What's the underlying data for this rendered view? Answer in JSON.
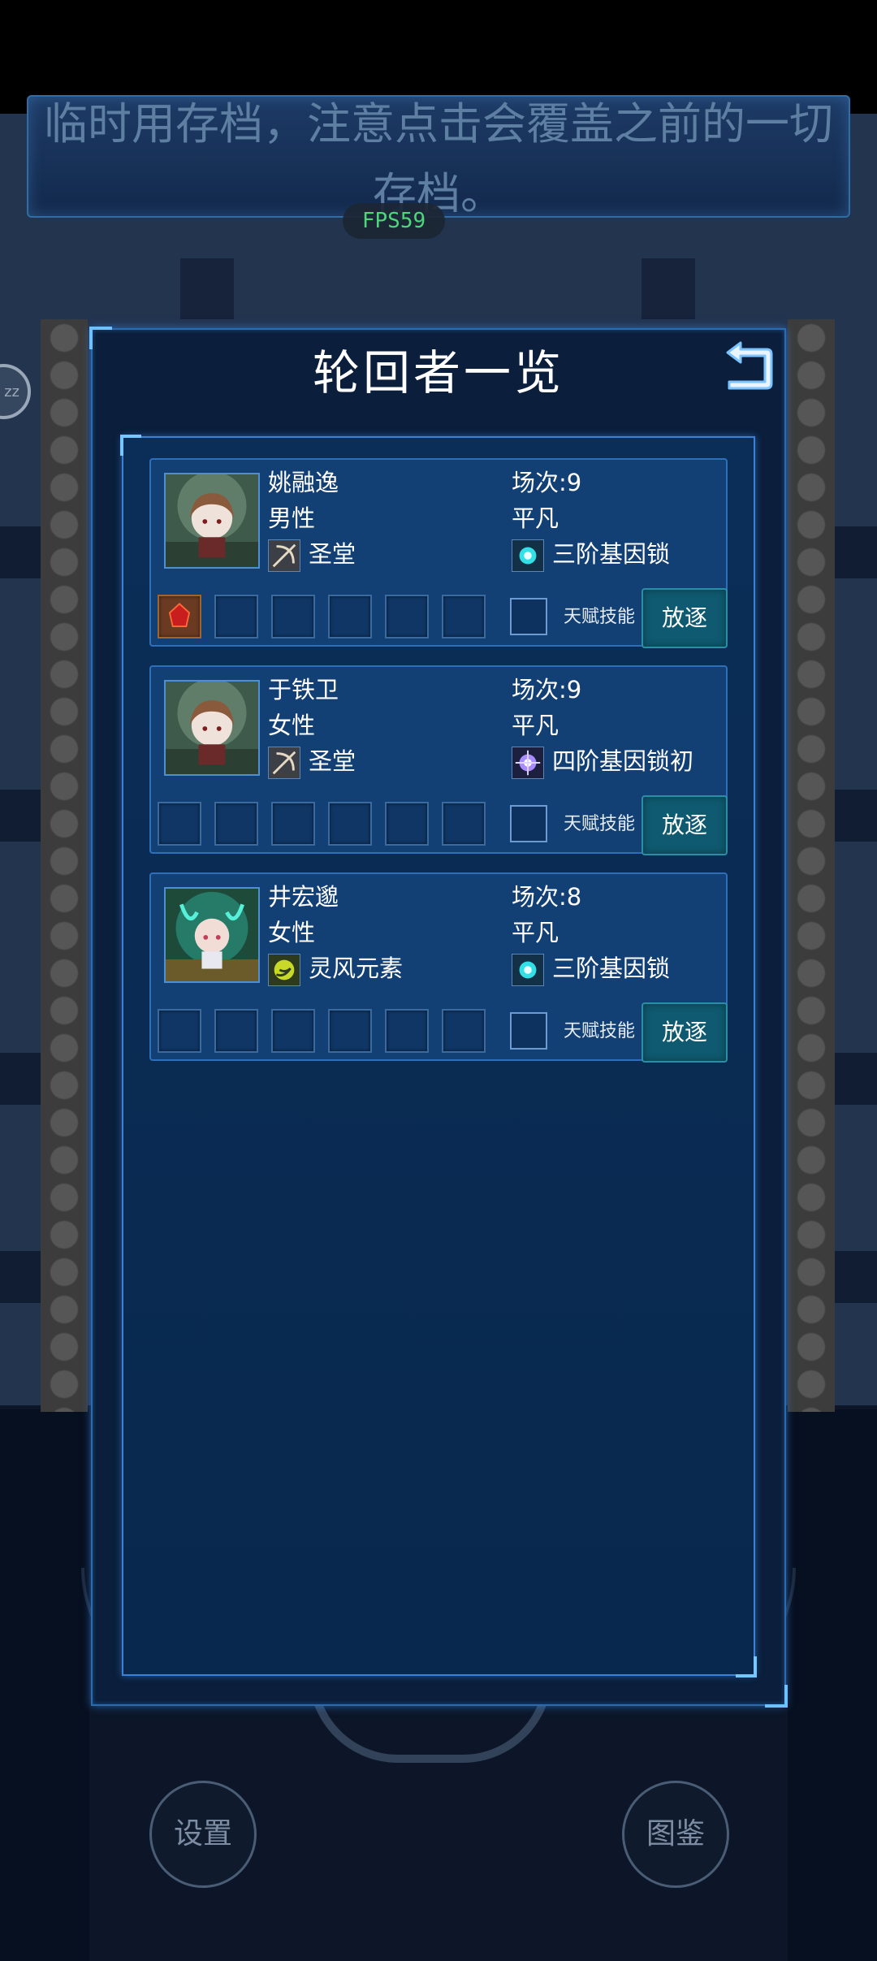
{
  "notice": {
    "text": "临时用存档，注意点击会覆盖之前的一切存档。"
  },
  "overlay": {
    "fps": "FPS59",
    "zz": "zz"
  },
  "bottom_buttons": {
    "settings": "设置",
    "codex": "图鉴"
  },
  "dialog": {
    "title": "轮回者一览",
    "back_icon": "return-arrow-icon",
    "characters": [
      {
        "name": "姚融逸",
        "gender": "男性",
        "class": "圣堂",
        "class_icon": "crossbow-icon",
        "rounds": "场次:9",
        "grade": "平凡",
        "gene_lock": "三阶基因锁",
        "gene_icon": "cyan-burst-icon",
        "equipment_slots": [
          "red-gem-icon",
          "",
          "",
          "",
          "",
          ""
        ],
        "talent_label": "天赋技能",
        "exile_label": "放逐"
      },
      {
        "name": "于铁卫",
        "gender": "女性",
        "class": "圣堂",
        "class_icon": "crossbow-icon",
        "rounds": "场次:9",
        "grade": "平凡",
        "gene_lock": "四阶基因锁初",
        "gene_icon": "violet-burst-icon",
        "equipment_slots": [
          "",
          "",
          "",
          "",
          "",
          ""
        ],
        "talent_label": "天赋技能",
        "exile_label": "放逐"
      },
      {
        "name": "井宏邈",
        "gender": "女性",
        "class": "灵风元素",
        "class_icon": "wind-element-icon",
        "rounds": "场次:8",
        "grade": "平凡",
        "gene_lock": "三阶基因锁",
        "gene_icon": "cyan-burst-icon",
        "equipment_slots": [
          "",
          "",
          "",
          "",
          "",
          ""
        ],
        "talent_label": "天赋技能",
        "exile_label": "放逐"
      }
    ]
  },
  "colors": {
    "accent": "#3b82d6",
    "exile_button": "#0f5a70",
    "fps": "#4ed67b",
    "card": "#123f74"
  }
}
